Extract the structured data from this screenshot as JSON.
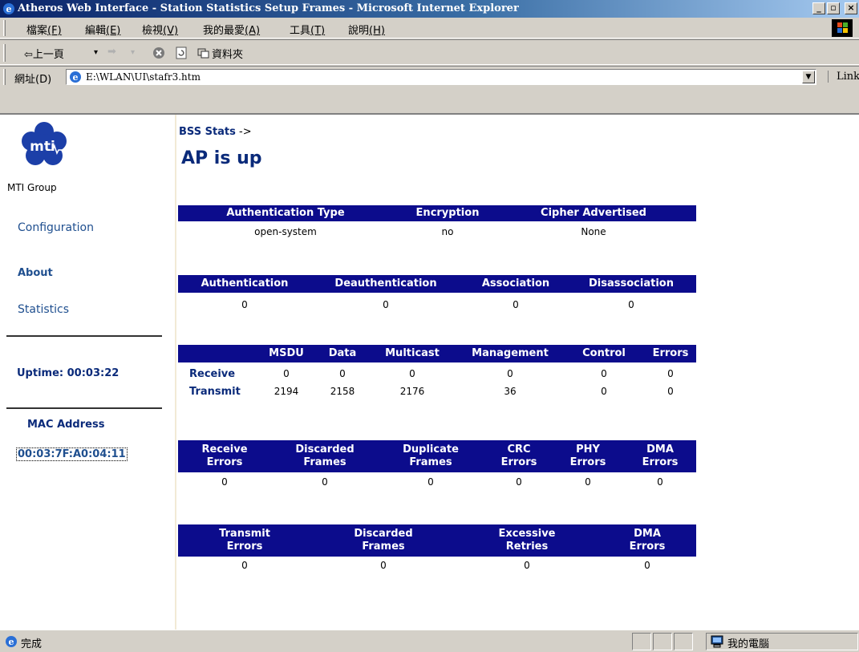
{
  "window": {
    "title": "Atheros Web Interface - Station Statistics Setup Frames - Microsoft Internet Explorer",
    "buttons": {
      "minimize": "_",
      "maximize": "▫",
      "close": "×"
    }
  },
  "menubar": {
    "items": [
      {
        "label": "檔案",
        "key": "(F)"
      },
      {
        "label": "編輯",
        "key": "(E)"
      },
      {
        "label": "檢視",
        "key": "(V)"
      },
      {
        "label": "我的最愛",
        "key": "(A)"
      },
      {
        "label": "工具",
        "key": "(T)"
      },
      {
        "label": "說明",
        "key": "(H)"
      }
    ]
  },
  "toolbar": {
    "back": "⇦上一頁",
    "back_dropdown": "▾",
    "forward": "➡",
    "forward_dropdown": "▾",
    "folders": "資料夾"
  },
  "addressbar": {
    "label": "網址(D)",
    "value": "E:\\WLAN\\UI\\stafr3.htm",
    "links": "Links"
  },
  "sidebar": {
    "group_name": "MTI Group",
    "logo_text": "mti",
    "links": {
      "configuration": "Configuration",
      "about": "About",
      "statistics": "Statistics"
    },
    "uptime": "Uptime: 00:03:22",
    "mac_label": "MAC Address",
    "mac_value": "00:03:7F:A0:04:11"
  },
  "main": {
    "breadcrumb": {
      "label": "BSS Stats",
      "arrow": " ->"
    },
    "ap_status": "AP is  up",
    "table1": {
      "headers": [
        "Authentication Type",
        "Encryption",
        "Cipher Advertised"
      ],
      "values": [
        "open-system",
        "no",
        "None"
      ]
    },
    "table2": {
      "headers": [
        "Authentication",
        "Deauthentication",
        "Association",
        "Disassociation"
      ],
      "values": [
        "0",
        "0",
        "0",
        "0"
      ]
    },
    "table3": {
      "headers": [
        "MSDU",
        "Data",
        "Multicast",
        "Management",
        "Control",
        "Errors"
      ],
      "rows": [
        {
          "label": "Receive",
          "values": [
            "0",
            "0",
            "0",
            "0",
            "0",
            "0"
          ]
        },
        {
          "label": "Transmit",
          "values": [
            "2194",
            "2158",
            "2176",
            "36",
            "0",
            "0"
          ]
        }
      ]
    },
    "table4": {
      "headers": [
        [
          "Receive",
          "Errors"
        ],
        [
          "Discarded",
          "Frames"
        ],
        [
          "Duplicate",
          "Frames"
        ],
        [
          "CRC",
          "Errors"
        ],
        [
          "PHY",
          "Errors"
        ],
        [
          "DMA",
          "Errors"
        ]
      ],
      "values": [
        "0",
        "0",
        "0",
        "0",
        "0",
        "0"
      ]
    },
    "table5": {
      "headers": [
        [
          "Transmit",
          "Errors"
        ],
        [
          "Discarded",
          "Frames"
        ],
        [
          "Excessive",
          "Retries"
        ],
        [
          "DMA",
          "Errors"
        ]
      ],
      "values": [
        "0",
        "0",
        "0",
        "0"
      ]
    }
  },
  "statusbar": {
    "status": "完成",
    "zone": "我的電腦"
  },
  "colors": {
    "header_bg": "#0c0c8c",
    "link": "#1f4f8f",
    "titlebar_start": "#0a246a"
  }
}
